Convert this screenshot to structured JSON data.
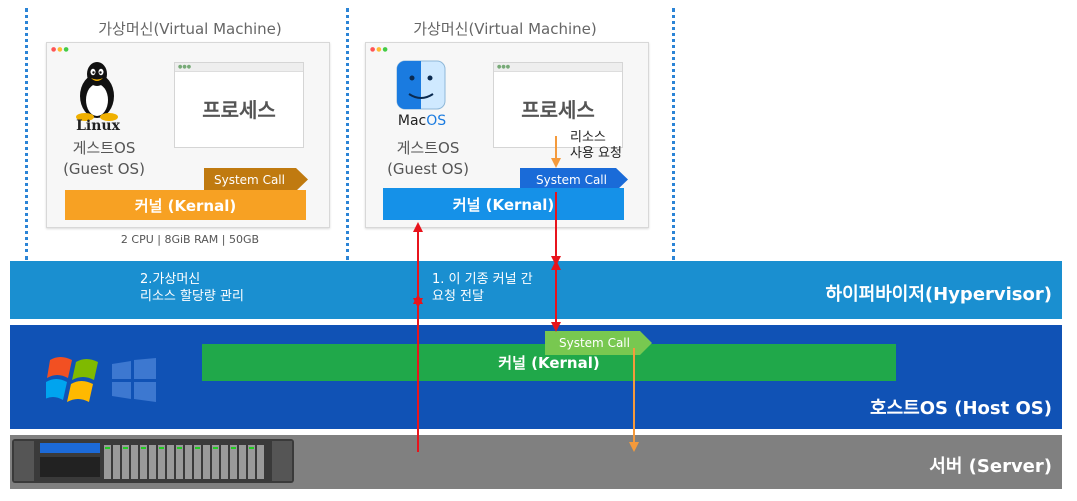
{
  "vm_left": {
    "title": "가상머신(Virtual Machine)",
    "os_logo_text": "Linux",
    "guest_os_line1": "게스트OS",
    "guest_os_line2": "(Guest OS)",
    "process_label": "프로세스",
    "system_call_label": "System Call",
    "kernel_label": "커널 (Kernal)",
    "spec": "2 CPU | 8GiB RAM | 50GB"
  },
  "vm_right": {
    "title": "가상머신(Virtual Machine)",
    "os_logo_text_a": "Mac",
    "os_logo_text_b": "OS",
    "guest_os_line1": "게스트OS",
    "guest_os_line2": "(Guest OS)",
    "process_label": "프로세스",
    "resource_request_line1": "리소스",
    "resource_request_line2": "사용 요청",
    "system_call_label": "System Call",
    "kernel_label": "커널 (Kernal)"
  },
  "hypervisor": {
    "label": "하이퍼바이저(Hypervisor)",
    "note_left_line1": "2.가상머신",
    "note_left_line2": "리소스 할당량 관리",
    "note_mid_line1": "1. 이 기종 커널 간",
    "note_mid_line2": "요청 전달"
  },
  "host_os": {
    "label": "호스트OS (Host OS)",
    "kernel_label": "커널 (Kernal)",
    "system_call_label": "System Call"
  },
  "server": {
    "label": "서버 (Server)"
  },
  "colors": {
    "hypervisor": "#1a8fd0",
    "host_os": "#1052b5",
    "server": "#808080",
    "kernel_orange": "#f7a123",
    "kernel_blue": "#1591e8",
    "kernel_green": "#20a84a",
    "arrow_red": "#e8141c",
    "arrow_orange": "#f49a3c"
  }
}
